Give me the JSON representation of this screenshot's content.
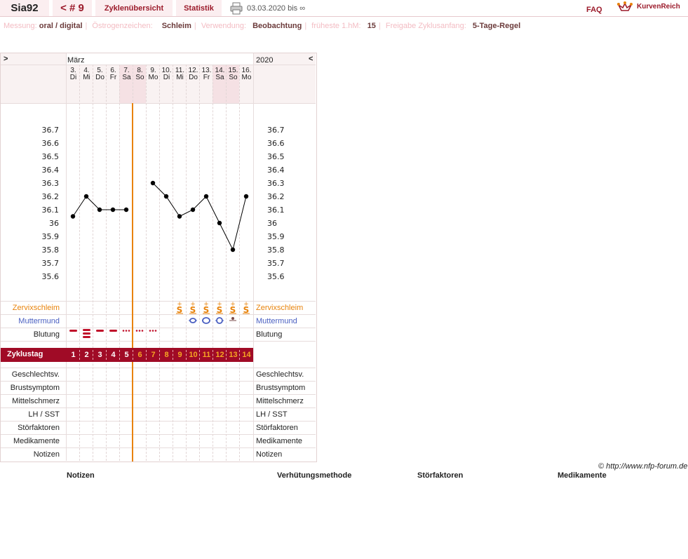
{
  "header": {
    "user": "Sia92",
    "cycle_nav": "< # 9",
    "tabs": [
      "Zyklenübersicht",
      "Statistik"
    ],
    "date_range": "03.03.2020 bis ∞",
    "faq": "FAQ",
    "brand": "KurvenReich",
    "print_icon": "printer-icon"
  },
  "info": [
    {
      "label": "Messung:",
      "value": "oral / digital"
    },
    {
      "label": "Östrogenzeichen:",
      "value": "Schleim"
    },
    {
      "label": "Verwendung:",
      "value": "Beobachtung"
    },
    {
      "label": "früheste 1.hM:",
      "value": "15"
    },
    {
      "label": "Freigabe Zyklusanfang:",
      "value": "5-Tage-Regel"
    }
  ],
  "chart_nav": {
    "prev": ">",
    "next": "<",
    "month": "März",
    "year": "2020"
  },
  "days": [
    {
      "d": "3.",
      "w": "Di"
    },
    {
      "d": "4.",
      "w": "Mi"
    },
    {
      "d": "5.",
      "w": "Do"
    },
    {
      "d": "6.",
      "w": "Fr"
    },
    {
      "d": "7.",
      "w": "Sa"
    },
    {
      "d": "8.",
      "w": "So"
    },
    {
      "d": "9.",
      "w": "Mo"
    },
    {
      "d": "10.",
      "w": "Di"
    },
    {
      "d": "11.",
      "w": "Mi"
    },
    {
      "d": "12.",
      "w": "Do"
    },
    {
      "d": "13.",
      "w": "Fr"
    },
    {
      "d": "14.",
      "w": "Sa"
    },
    {
      "d": "15.",
      "w": "So"
    },
    {
      "d": "16.",
      "w": "Mo"
    }
  ],
  "chart_data": {
    "type": "line",
    "y_ticks": [
      "36.7",
      "36.6",
      "36.5",
      "36.4",
      "36.3",
      "36.2",
      "36.1",
      "36",
      "35.9",
      "35.8",
      "35.7",
      "35.6"
    ],
    "ylim": [
      35.6,
      36.7
    ],
    "x": [
      "3.",
      "4.",
      "5.",
      "6.",
      "7.",
      "8.",
      "9.",
      "10.",
      "11.",
      "12.",
      "13.",
      "14.",
      "15.",
      "16."
    ],
    "segments": [
      {
        "x": [
          1,
          2,
          3,
          4,
          5
        ],
        "values": [
          36.05,
          36.2,
          36.1,
          36.1,
          36.1
        ]
      },
      {
        "x": [
          7,
          8,
          9,
          10,
          11,
          12,
          13,
          14
        ],
        "values": [
          36.3,
          36.2,
          36.05,
          36.1,
          36.2,
          36.0,
          35.8,
          36.2
        ]
      }
    ],
    "marker_day": 5.5,
    "grid": true
  },
  "rows": {
    "zervix": "Zervixschleim",
    "muttermund": "Muttermund",
    "blutung": "Blutung",
    "zyklustag": "Zyklustag",
    "geschlecht": "Geschlechtsv.",
    "brust": "Brustsymptom",
    "mittel": "Mittelschmerz",
    "lh": "LH / SST",
    "stoer": "Störfaktoren",
    "medi": "Medikamente",
    "notizen": "Notizen"
  },
  "zervix_symbol": "S",
  "zyklustage": [
    "1",
    "2",
    "3",
    "4",
    "5",
    "6",
    "7",
    "8",
    "9",
    "10",
    "11",
    "12",
    "13",
    "14"
  ],
  "copyright": "© http://www.nfp-forum.de",
  "footer": [
    "Notizen",
    "Verhütungsmethode",
    "Störfaktoren",
    "Medikamente"
  ],
  "colors": {
    "accent": "#9b1a2a",
    "orange": "#e8830c",
    "blue": "#4a5fc1",
    "zyklus_bg": "#a00b26"
  }
}
